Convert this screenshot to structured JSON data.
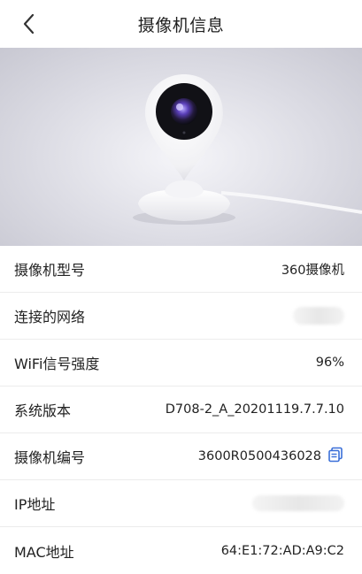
{
  "header": {
    "title": "摄像机信息",
    "back_icon": "chevron-left-icon"
  },
  "hero": {
    "image": "camera-product-photo"
  },
  "rows": [
    {
      "label": "摄像机型号",
      "value": "360摄像机"
    },
    {
      "label": "连接的网络",
      "value": ""
    },
    {
      "label": "WiFi信号强度",
      "value": "96%"
    },
    {
      "label": "系统版本",
      "value": "D708-2_A_20201119.7.7.10"
    },
    {
      "label": "摄像机编号",
      "value": "3600R0500436028",
      "icon": "copy-icon"
    },
    {
      "label": "IP地址",
      "value": ""
    },
    {
      "label": "MAC地址",
      "value": "64:E1:72:AD:A9:C2"
    }
  ],
  "colors": {
    "accent": "#3a6fd8",
    "text": "#222222",
    "divider": "#ececec"
  }
}
